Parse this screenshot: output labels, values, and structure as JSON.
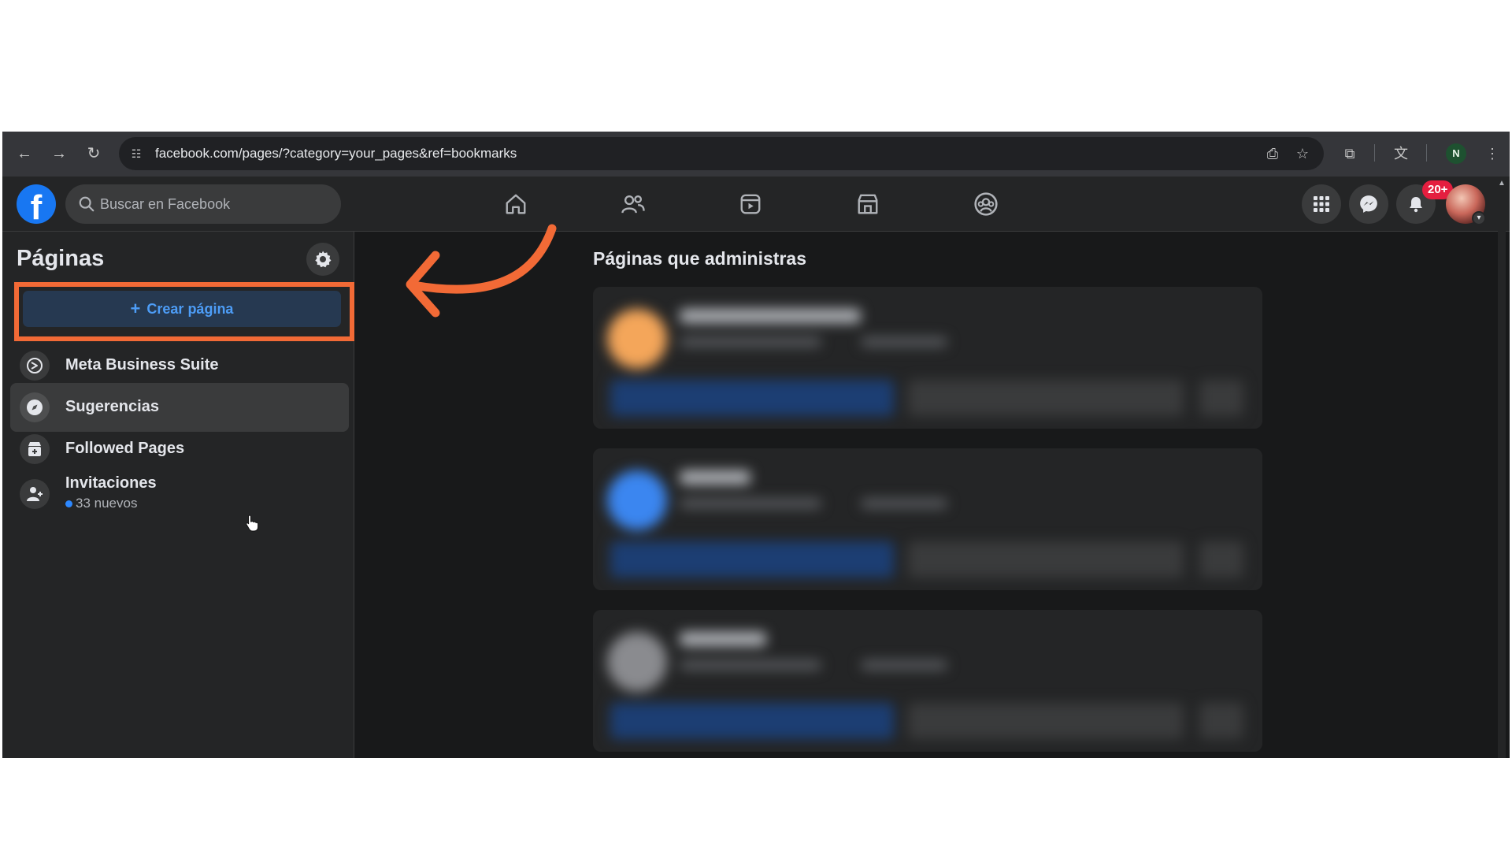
{
  "browser": {
    "url": "facebook.com/pages/?category=your_pages&ref=bookmarks",
    "profile_initial": "N"
  },
  "header": {
    "logo": "f",
    "search_placeholder": "Buscar en Facebook",
    "nav_tabs": [
      "home-icon",
      "friends-icon",
      "video-icon",
      "marketplace-icon",
      "groups-icon"
    ],
    "notifications_badge": "20+"
  },
  "sidebar": {
    "title": "Páginas",
    "create_button": "Crear página",
    "items": [
      {
        "label": "Meta Business Suite",
        "icon": "meta-business-icon"
      },
      {
        "label": "Sugerencias",
        "icon": "compass-icon"
      },
      {
        "label": "Followed Pages",
        "icon": "followed-pages-icon"
      },
      {
        "label": "Invitaciones",
        "icon": "invite-user-icon",
        "sub": "33 nuevos"
      }
    ]
  },
  "main": {
    "title": "Páginas que administras"
  },
  "colors": {
    "accent": "#f26a36",
    "brand": "#1877f2",
    "badge": "#e41e3f"
  }
}
